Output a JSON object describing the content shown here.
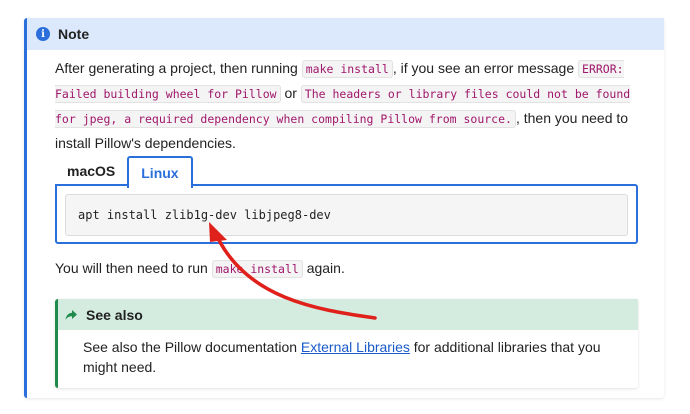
{
  "note": {
    "title": "Note",
    "para1": {
      "t1": "After generating a project, then running ",
      "c1": "make install",
      "t2": ", if you see an error message ",
      "c2": "ERROR: Failed building wheel for Pillow",
      "t3": " or ",
      "c3": "The headers or library files could not be found for jpeg, a required dependency when compiling Pillow from source.",
      "t4": ", then you need to install Pillow's dependencies."
    },
    "tabs": [
      {
        "label": "macOS",
        "active": false
      },
      {
        "label": "Linux",
        "active": true
      }
    ],
    "code": "apt install zlib1g-dev libjpeg8-dev",
    "para2": {
      "t1": "You will then need to run ",
      "c1": "make install",
      "t2": " again."
    },
    "seealso": {
      "title": "See also",
      "t1": "See also the Pillow documentation ",
      "link": "External Libraries",
      "t2": " for additional libraries that you might need."
    }
  },
  "colors": {
    "note_accent": "#2a6fdb",
    "note_header_bg": "#dce8fb",
    "seealso_accent": "#1f8a4c",
    "seealso_header_bg": "#d3ecdf",
    "inline_code": "#a0176b",
    "annotation_arrow": "#e0201a"
  },
  "icons": {
    "note": "info-icon",
    "seealso": "share-arrow-icon",
    "annotation": "red-curved-arrow"
  }
}
